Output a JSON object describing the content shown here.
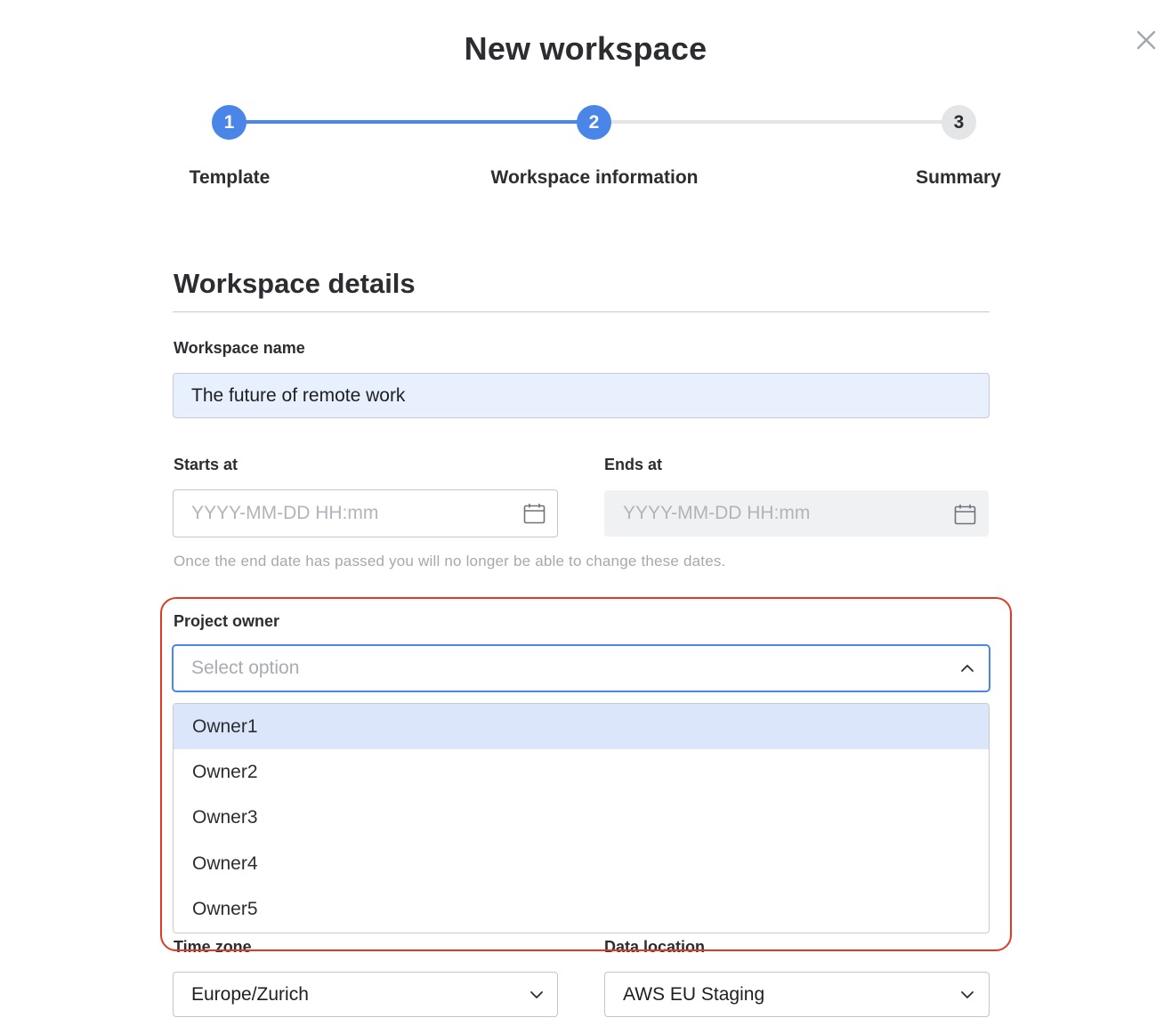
{
  "dialog": {
    "title": "New workspace",
    "close_icon": "close-icon"
  },
  "stepper": {
    "steps": [
      {
        "number": "1",
        "label": "Template",
        "state": "completed"
      },
      {
        "number": "2",
        "label": "Workspace information",
        "state": "current"
      },
      {
        "number": "3",
        "label": "Summary",
        "state": "pending"
      }
    ],
    "active_color": "#4a86e8",
    "inactive_color": "#e4e5e7"
  },
  "section": {
    "title": "Workspace details"
  },
  "fields": {
    "workspace_name": {
      "label": "Workspace name",
      "value": "The future of remote work"
    },
    "starts_at": {
      "label": "Starts at",
      "placeholder": "YYYY-MM-DD HH:mm",
      "icon": "calendar-icon"
    },
    "ends_at": {
      "label": "Ends at",
      "placeholder": "YYYY-MM-DD HH:mm",
      "icon": "calendar-icon",
      "disabled": true
    },
    "date_hint": "Once the end date has passed you will no longer be able to change these dates.",
    "project_owner": {
      "label": "Project owner",
      "placeholder": "Select option",
      "icon": "chevron-up-icon",
      "options": [
        "Owner1",
        "Owner2",
        "Owner3",
        "Owner4",
        "Owner5"
      ],
      "highlighted_option": "Owner1"
    },
    "time_zone": {
      "label": "Time zone",
      "value": "Europe/Zurich",
      "icon": "chevron-down-icon"
    },
    "data_location": {
      "label": "Data location",
      "value": "AWS EU Staging",
      "icon": "chevron-down-icon"
    }
  },
  "annotation": {
    "highlight_color": "#e03a24"
  }
}
